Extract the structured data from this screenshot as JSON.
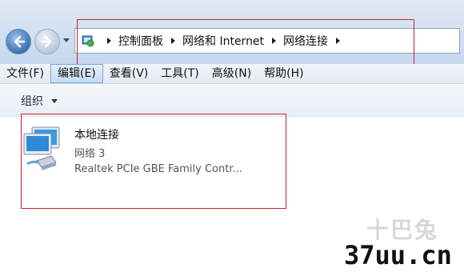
{
  "breadcrumbs": [
    "控制面板",
    "网络和 Internet",
    "网络连接"
  ],
  "menu": [
    {
      "label": "文件(F)",
      "active": false
    },
    {
      "label": "编辑(E)",
      "active": true
    },
    {
      "label": "查看(V)",
      "active": false
    },
    {
      "label": "工具(T)",
      "active": false
    },
    {
      "label": "高级(N)",
      "active": false
    },
    {
      "label": "帮助(H)",
      "active": false
    }
  ],
  "toolbar": {
    "organize_label": "组织"
  },
  "connection": {
    "name": "本地连接",
    "network": "网络  3",
    "adapter": "Realtek PCIe GBE Family Contr..."
  },
  "watermark": {
    "faint": "十巴兔",
    "brand": "37uu.cn"
  },
  "colors": {
    "highlight_box": "#c8242e"
  }
}
